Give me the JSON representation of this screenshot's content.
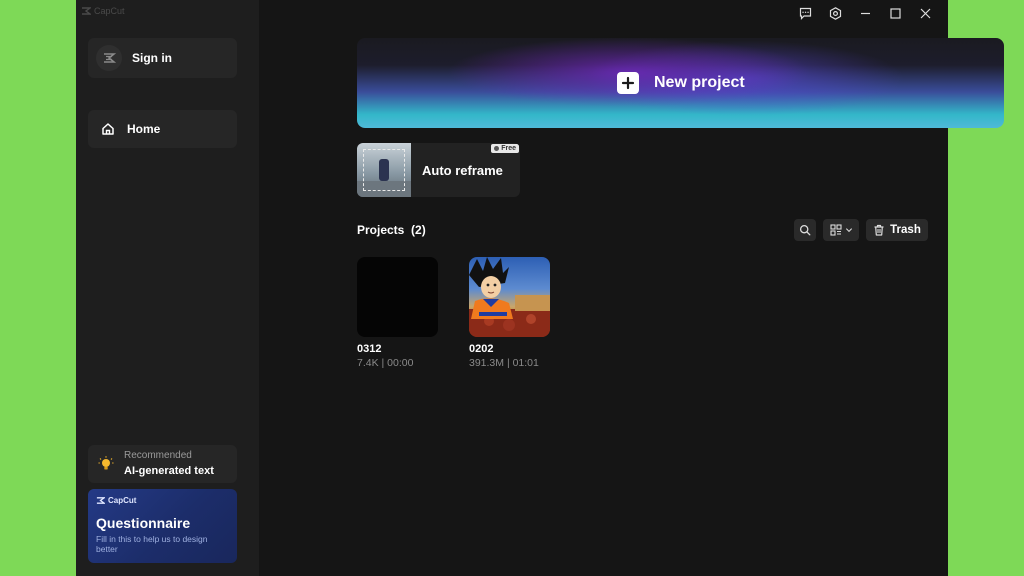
{
  "app": {
    "logo_text": "CapCut"
  },
  "titlebar": {
    "icons": [
      "feedback-icon",
      "settings-icon",
      "minimize-icon",
      "maximize-icon",
      "close-icon"
    ]
  },
  "sidebar": {
    "signin_label": "Sign in",
    "home_label": "Home",
    "recommended": {
      "small": "Recommended",
      "title": "AI-generated text"
    },
    "questionnaire": {
      "logo": "CapCut",
      "title": "Questionnaire",
      "desc": "Fill in this to help us to design better"
    }
  },
  "main": {
    "new_project_label": "New project",
    "auto_reframe": {
      "label": "Auto reframe",
      "badge": "Free"
    },
    "projects": {
      "title": "Projects",
      "count": "(2)",
      "trash_label": "Trash",
      "items": [
        {
          "name": "0312",
          "meta": "7.4K | 00:00"
        },
        {
          "name": "0202",
          "meta": "391.3M | 01:01"
        }
      ]
    }
  },
  "colors": {
    "background": "#7ed957",
    "app_bg": "#161616",
    "sidebar_bg": "#1e1e1e",
    "accent_gradient_cyan": "#33b7c9",
    "accent_gradient_purple": "#7828c8"
  }
}
